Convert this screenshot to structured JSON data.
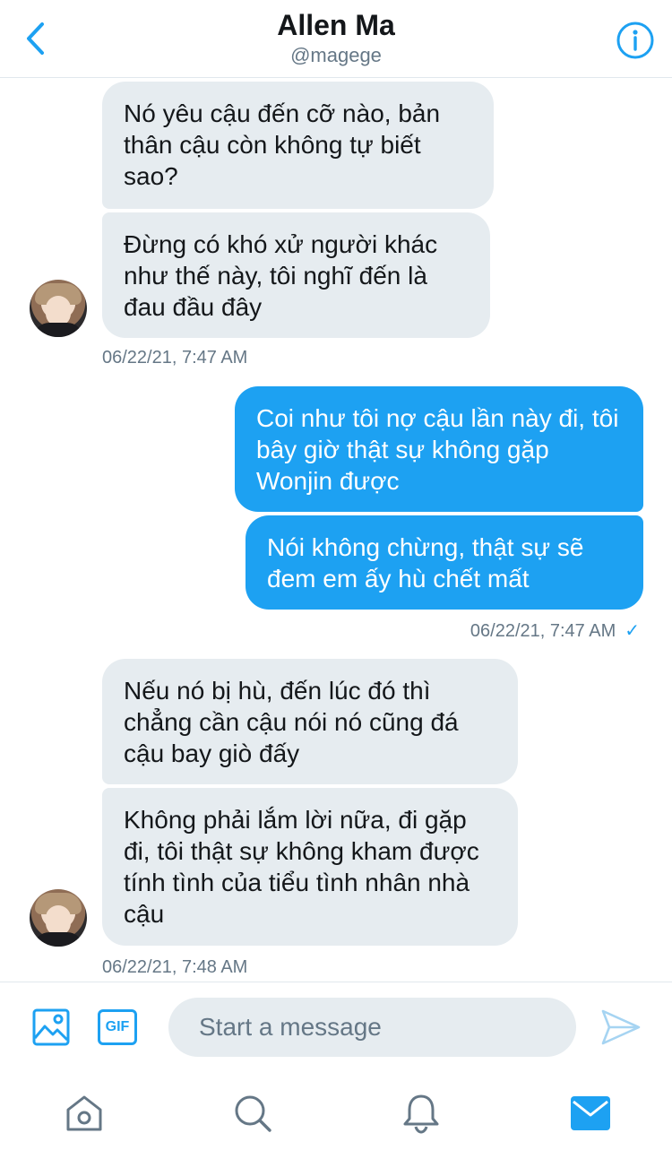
{
  "header": {
    "title": "Allen Ma",
    "handle": "@magege",
    "back_icon": "chevron-left-icon",
    "info_icon": "info-icon"
  },
  "messages": [
    {
      "direction": "in",
      "text": "Nó yêu cậu đến cỡ nào, bản thân cậu còn không tự biết sao?"
    },
    {
      "direction": "in",
      "text": "Đừng có khó xử người khác như thế này, tôi nghĩ đến là đau đầu đây"
    },
    {
      "direction": "out",
      "text": "Coi như tôi nợ cậu lần này đi, tôi bây giờ thật sự không gặp Wonjin được"
    },
    {
      "direction": "out",
      "text": "Nói không chừng, thật sự sẽ đem em ấy hù chết mất"
    },
    {
      "direction": "in",
      "text": "Nếu nó bị hù, đến lúc đó thì chẳng cần cậu nói nó cũng đá cậu bay giò đấy"
    },
    {
      "direction": "in",
      "text": "Không phải lắm lời nữa, đi gặp đi, tôi thật sự không kham được tính tình của tiểu tình nhân nhà cậu"
    }
  ],
  "timestamps": [
    "06/22/21, 7:47 AM",
    "06/22/21, 7:47 AM",
    "06/22/21, 7:48 AM"
  ],
  "read_mark": "✓",
  "composer": {
    "placeholder": "Start a message",
    "gif_label": "GIF",
    "image_icon": "image-icon",
    "send_icon": "send-icon"
  },
  "tabs": [
    "home-icon",
    "search-icon",
    "notifications-icon",
    "messages-icon"
  ],
  "colors": {
    "accent": "#1da1f2",
    "incoming_bubble": "#e6ecf0",
    "secondary_text": "#657786",
    "primary_text": "#14171a"
  }
}
